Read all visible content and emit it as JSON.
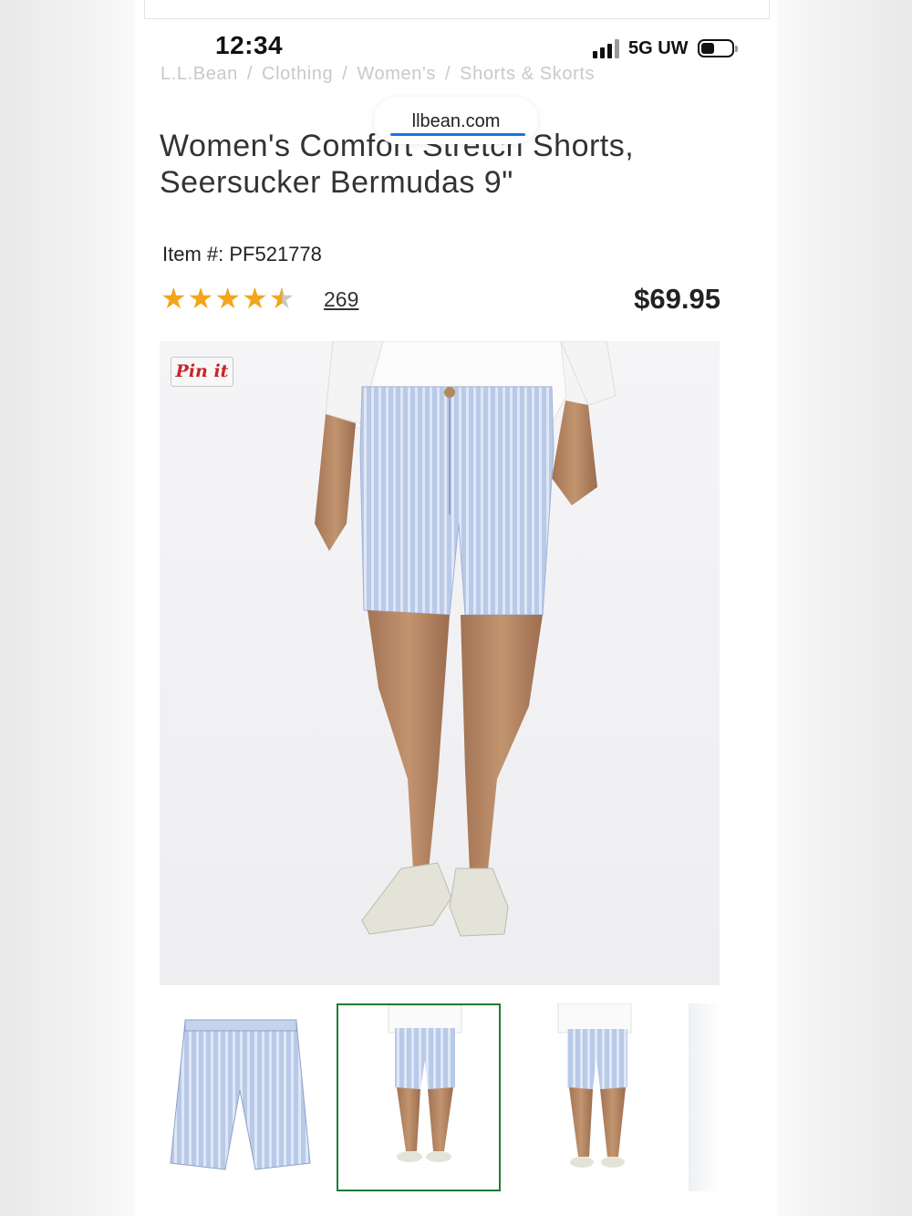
{
  "status": {
    "time": "12:34",
    "network": "5G UW"
  },
  "breadcrumb": {
    "items": [
      "L.L.Bean",
      "Clothing",
      "Women's",
      "Shorts & Skorts"
    ],
    "separator": "/"
  },
  "url": {
    "domain": "llbean.com"
  },
  "product": {
    "title_line1": "Women's Comfort Stretch Shorts,",
    "title_line2": "Seersucker Bermudas 9\"",
    "item_number": "Item #: PF521778",
    "rating": 4.5,
    "stars": "★★★★",
    "half_star": "★",
    "reviews": "269",
    "price": "$69.95"
  },
  "pin_button": {
    "label": "Pin it"
  },
  "gallery": {
    "selected_index": 1,
    "thumbnails": [
      "flat-front",
      "front-on-model",
      "back-on-model",
      "fabric-detail"
    ]
  },
  "colors": {
    "accent_selected": "#217a35",
    "star": "#f3a51b",
    "pin_red": "#c8232c"
  }
}
